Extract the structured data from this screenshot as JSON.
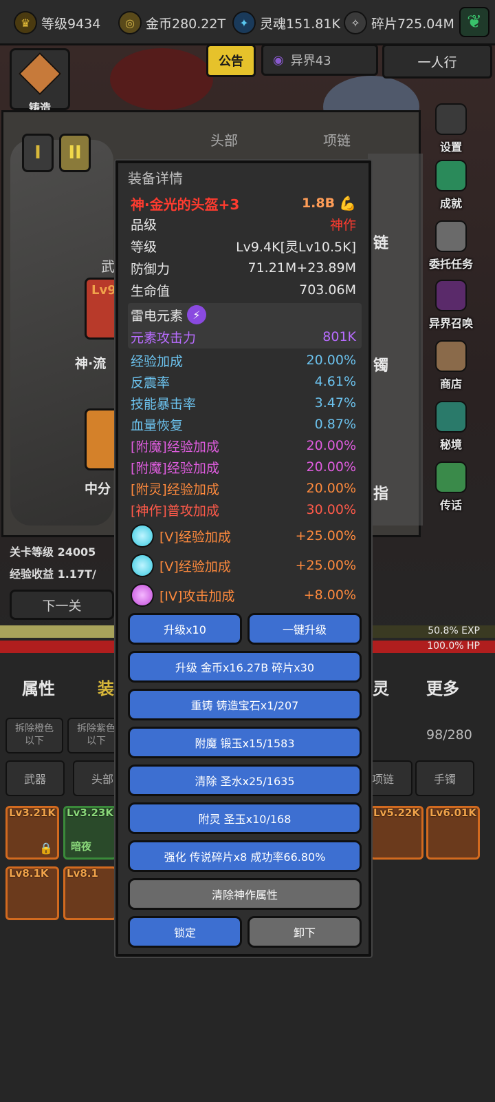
{
  "topbar": {
    "level": "等级9434",
    "gold": "金币280.22T",
    "soul": "灵魂151.81K",
    "fragments": "碎片725.04M"
  },
  "header": {
    "notice": "公告",
    "otherworld": "异界43",
    "solo": "一人行"
  },
  "underlay": {
    "roman_tabs": [
      "I",
      "II"
    ],
    "tabs": [
      "头部",
      "项链"
    ],
    "peek": {
      "forge": "铸造",
      "weapon": "武",
      "lv": "Lv9",
      "item1": "神·流",
      "item2": "中分",
      "chain": "链",
      "bracelet": "镯",
      "ring": "指"
    }
  },
  "side_menu": [
    {
      "label": "设置",
      "icon": "gear-icon"
    },
    {
      "label": "成就",
      "icon": "star-icon"
    },
    {
      "label": "委托任务",
      "icon": "scroll-icon"
    },
    {
      "label": "异界召唤",
      "icon": "portal-icon"
    },
    {
      "label": "商店",
      "icon": "shop-bag-icon"
    },
    {
      "label": "秘境",
      "icon": "spiral-icon"
    },
    {
      "label": "传话",
      "icon": "megaphone-icon"
    }
  ],
  "stage": {
    "level_label": "关卡等级 24005",
    "exp_label": "经验收益 1.17T/",
    "next": "下一关",
    "exp_percent": "50.8% EXP",
    "exp_fraction": 0.508,
    "hp_percent": "100.0% HP"
  },
  "bottom": {
    "tabs": [
      "属性",
      "装",
      "灵",
      "更多"
    ],
    "filters": [
      {
        "l1": "拆除橙色",
        "l2": "以下"
      },
      {
        "l1": "拆除紫色",
        "l2": "以下"
      }
    ],
    "count": "98/280",
    "categories": [
      "武器",
      "头部",
      "项链",
      "手镯"
    ],
    "slots": [
      "Lv3.21K",
      "Lv3.23K",
      "Lv5.22K",
      "Lv6.01K",
      "Lv8.1K",
      "Lv8.1"
    ],
    "slot_tag": "暗夜"
  },
  "modal": {
    "title": "装备详情",
    "item_name": "神·金光的头盔+3",
    "power": "1.8B",
    "stats": [
      {
        "label": "品级",
        "value": "神作"
      },
      {
        "label": "等级",
        "value": "Lv9.4K[灵Lv10.5K]"
      },
      {
        "label": "防御力",
        "value": "71.21M+23.89M"
      },
      {
        "label": "生命值",
        "value": "703.06M"
      }
    ],
    "element": {
      "name": "雷电元素",
      "stat": "元素攻击力",
      "value": "801K"
    },
    "bonus": [
      {
        "label": "经验加成",
        "value": "20.00%"
      },
      {
        "label": "反震率",
        "value": "4.61%"
      },
      {
        "label": "技能暴击率",
        "value": "3.47%"
      },
      {
        "label": "血量恢复",
        "value": "0.87%"
      }
    ],
    "enchant": [
      {
        "label": "[附魔]经验加成",
        "value": "20.00%"
      },
      {
        "label": "[附魔]经验加成",
        "value": "20.00%"
      }
    ],
    "spirit": {
      "label": "[附灵]经验加成",
      "value": "20.00%"
    },
    "divine": {
      "label": "[神作]普攻加成",
      "value": "30.00%"
    },
    "gems": [
      {
        "label": "[V]经验加成",
        "value": "+25.00%",
        "color": "#36c9e0"
      },
      {
        "label": "[V]经验加成",
        "value": "+25.00%",
        "color": "#36c9e0"
      },
      {
        "label": "[IV]攻击加成",
        "value": "+8.00%",
        "color": "#c24ad9"
      }
    ],
    "buttons": {
      "upgrade10": "升级x10",
      "upgrade_all": "一键升级",
      "upgrade": "升级 金币x16.27B 碎片x30",
      "reforge": "重铸 铸造宝石x1/207",
      "enchant": "附魔 锻玉x15/1583",
      "clear": "清除 圣水x25/1635",
      "spirit": "附灵 圣玉x10/168",
      "strengthen": "强化 传说碎片x8 成功率66.80%",
      "clear_divine": "清除神作属性",
      "lock": "锁定",
      "unequip": "卸下"
    }
  },
  "colors": {
    "red_title": "#ff3b2f",
    "orange": "#ff8a3d",
    "blue_stat": "#6cc3ef",
    "purple": "#e05de0",
    "element_purple": "#b86cff",
    "power": "#ff9d57",
    "button_blue": "#3d6fd1"
  }
}
